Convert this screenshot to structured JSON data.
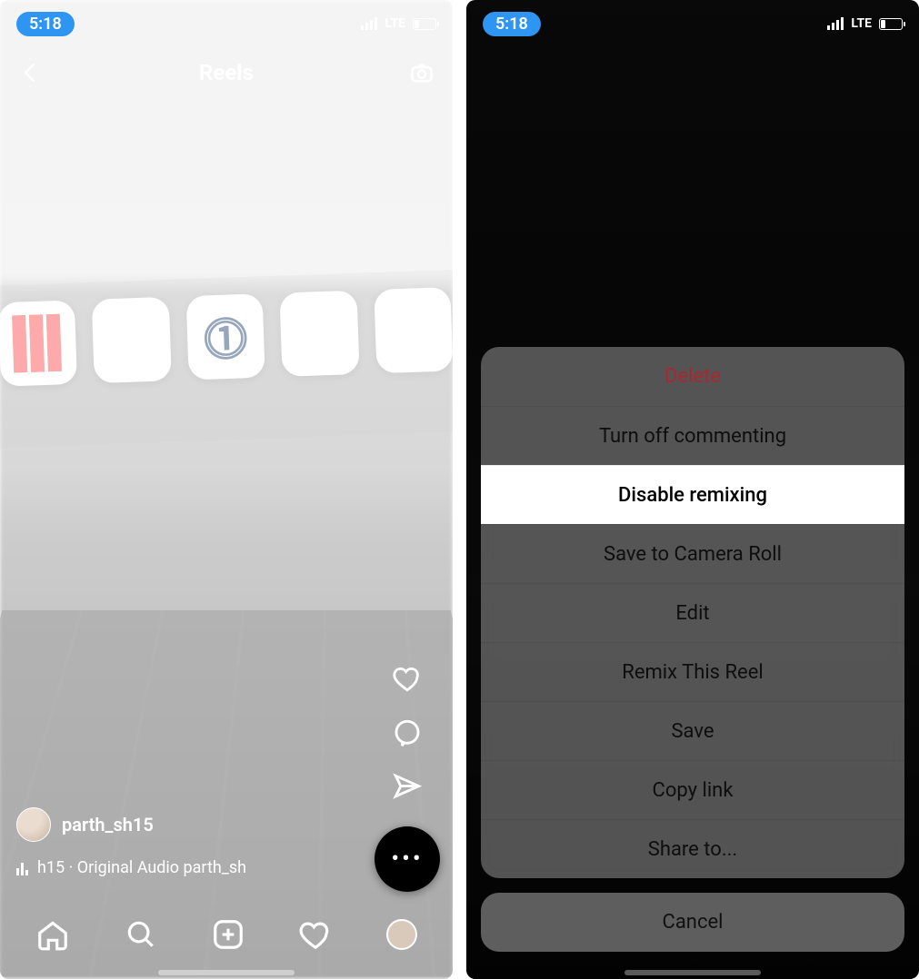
{
  "status": {
    "time": "5:18",
    "network": "LTE"
  },
  "left": {
    "header_title": "Reels",
    "username": "parth_sh15",
    "audio_line": "h15 · Original Audio   parth_sh"
  },
  "actionsheet": {
    "items": [
      {
        "label": "Delete",
        "destructive": true,
        "highlight": false
      },
      {
        "label": "Turn off commenting",
        "destructive": false,
        "highlight": false
      },
      {
        "label": "Disable remixing",
        "destructive": false,
        "highlight": true
      },
      {
        "label": "Save to Camera Roll",
        "destructive": false,
        "highlight": false
      },
      {
        "label": "Edit",
        "destructive": false,
        "highlight": false
      },
      {
        "label": "Remix This Reel",
        "destructive": false,
        "highlight": false
      },
      {
        "label": "Save",
        "destructive": false,
        "highlight": false
      },
      {
        "label": "Copy link",
        "destructive": false,
        "highlight": false
      },
      {
        "label": "Share to...",
        "destructive": false,
        "highlight": false
      }
    ],
    "cancel": "Cancel"
  }
}
